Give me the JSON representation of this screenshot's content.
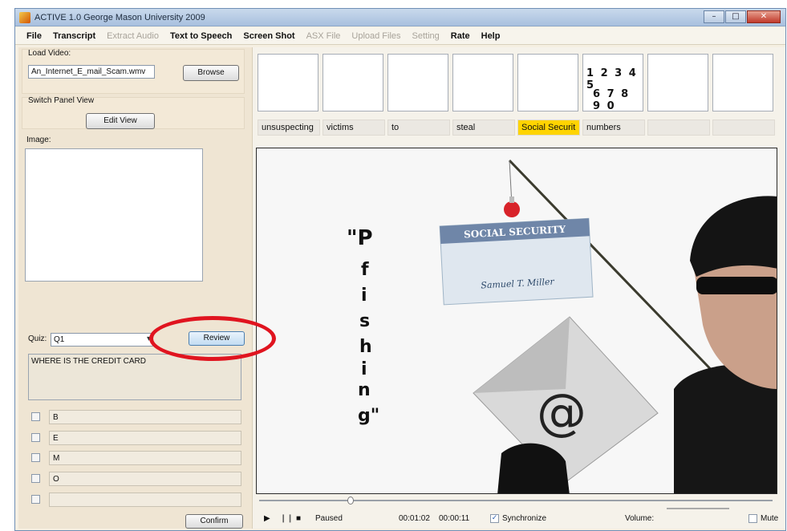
{
  "window": {
    "title": "ACTIVE 1.0 George Mason University 2009",
    "controls": {
      "minimize": "–",
      "maximize": "□",
      "close": "✕"
    }
  },
  "menu": [
    {
      "label": "File",
      "enabled": true
    },
    {
      "label": "Transcript",
      "enabled": true
    },
    {
      "label": "Extract Audio",
      "enabled": false
    },
    {
      "label": "Text to Speech",
      "enabled": true
    },
    {
      "label": "Screen Shot",
      "enabled": true
    },
    {
      "label": "ASX File",
      "enabled": false
    },
    {
      "label": "Upload Files",
      "enabled": false
    },
    {
      "label": "Setting",
      "enabled": false
    },
    {
      "label": "Rate",
      "enabled": true
    },
    {
      "label": "Help",
      "enabled": true
    }
  ],
  "left_panel": {
    "load_video_label": "Load Video:",
    "video_file": "An_Internet_E_mail_Scam.wmv",
    "browse_button": "Browse",
    "switch_panel_label": "Switch Panel View",
    "edit_view_button": "Edit View",
    "image_label": "Image:",
    "quiz_label": "Quiz:",
    "quiz_selected": "Q1",
    "review_button": "Review",
    "question_text": "WHERE IS THE CREDIT CARD",
    "options": [
      "B",
      "E",
      "M",
      "O",
      ""
    ],
    "confirm_button": "Confirm"
  },
  "transcript": {
    "thumb_digits_line1": "1 2 3 4 5",
    "thumb_digits_line2": "6 7 8 9 0",
    "words": [
      "unsuspecting",
      "victims",
      "to",
      "steal",
      "Social Securit",
      "numbers",
      "",
      ""
    ],
    "highlighted_index": 4
  },
  "video_frame": {
    "scene_text": [
      "\"P",
      "f",
      "i",
      "s",
      "h",
      "i",
      "n",
      "g\""
    ],
    "card_title": "SOCIAL SECURITY",
    "card_signature": "Samuel T. Miller",
    "envelope_symbol": "@"
  },
  "player": {
    "status": "Paused",
    "time_current": "00:01:02",
    "time_total": "00:00:11",
    "synchronize_label": "Synchronize",
    "synchronize_checked": true,
    "volume_label": "Volume:",
    "mute_label": "Mute",
    "mute_checked": false
  },
  "colors": {
    "highlight": "#ffd400",
    "annotation_ring": "#e0141f",
    "panel_bg": "#efe5d3"
  }
}
